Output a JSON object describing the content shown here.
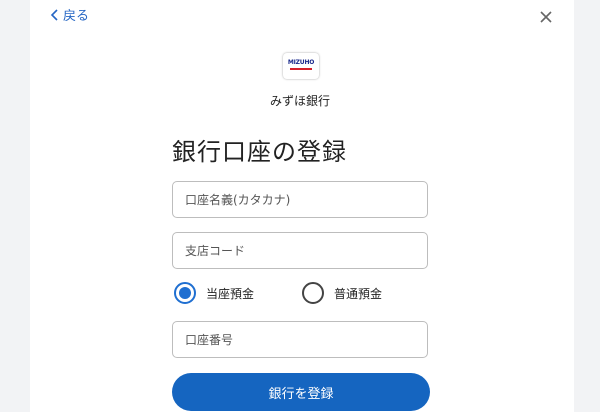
{
  "header": {
    "back_label": "戻る"
  },
  "bank": {
    "logo_text": "MIZUHO",
    "name": "みずほ銀行"
  },
  "form": {
    "title": "銀行口座の登録",
    "account_name_placeholder": "口座名義(カタカナ)",
    "branch_code_placeholder": "支店コード",
    "account_types": [
      {
        "label": "当座預金",
        "selected": true
      },
      {
        "label": "普通預金",
        "selected": false
      }
    ],
    "account_number_placeholder": "口座番号",
    "submit_label": "銀行を登録"
  },
  "colors": {
    "accent": "#1565c0",
    "link": "#2566c4",
    "logo_red": "#d6202a",
    "logo_navy": "#1a2a8c"
  }
}
